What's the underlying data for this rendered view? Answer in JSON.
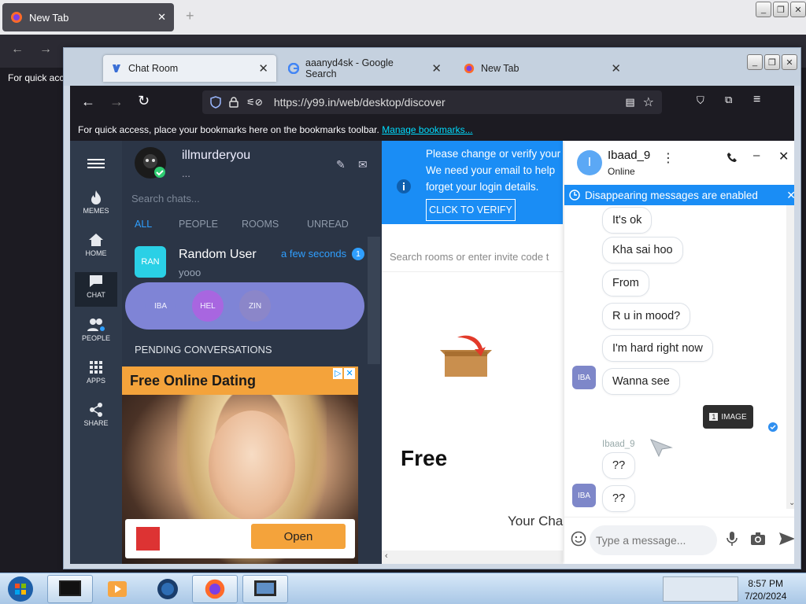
{
  "bg_window": {
    "tab_title": "New Tab",
    "bookmarks_text": "For quick acc"
  },
  "window": {
    "tabs": [
      {
        "label": "Chat Room",
        "active": true
      },
      {
        "label": "aaanyd4sk - Google Search"
      },
      {
        "label": "New Tab"
      }
    ],
    "url": "https://y99.in/web/desktop/discover",
    "bookmarks_bar": {
      "text": "For quick access, place your bookmarks here on the bookmarks toolbar.",
      "link": "Manage bookmarks..."
    }
  },
  "rail": {
    "items": [
      {
        "label": "MEMES",
        "icon": "flame-icon"
      },
      {
        "label": "HOME",
        "icon": "home-icon"
      },
      {
        "label": "CHAT",
        "icon": "chat-icon",
        "active": true
      },
      {
        "label": "PEOPLE",
        "icon": "people-icon"
      },
      {
        "label": "APPS",
        "icon": "apps-grid-icon"
      },
      {
        "label": "SHARE",
        "icon": "share-icon"
      }
    ]
  },
  "sidebar": {
    "username": "illmurderyou",
    "status": "...",
    "search_placeholder": "Search chats...",
    "filters": [
      "ALL",
      "PEOPLE",
      "ROOMS",
      "UNREAD"
    ],
    "active_filter": "ALL",
    "chats": [
      {
        "avatar": "RAN",
        "name": "Random User",
        "message": "yooo",
        "time": "a few seconds",
        "unread": "1"
      }
    ],
    "pill_avatars": [
      {
        "label": "IBA",
        "color": "#7f84d6"
      },
      {
        "label": "HEL",
        "color": "#a866e0"
      },
      {
        "label": "ZIN",
        "color": "#8b86c9"
      }
    ],
    "pending_label": "PENDING CONVERSATIONS"
  },
  "ad": {
    "title": "Free Online Dating",
    "button": "Open"
  },
  "middle": {
    "banner_lines": [
      "Please change or verify your",
      "We need your email to help",
      "forget your login details."
    ],
    "verify_button": "CLICK TO VERIFY",
    "search_placeholder": "Search rooms or enter invite code t",
    "free_text": "Free",
    "your_chat_text": "Your Cha"
  },
  "chat": {
    "avatar_letter": "I",
    "name": "Ibaad_9",
    "status": "Online",
    "disappearing_notice": "Disappearing messages are enabled",
    "messages": [
      {
        "text": "It's ok"
      },
      {
        "text": "Kha sai hoo"
      },
      {
        "text": "From"
      },
      {
        "text": "R u in mood?"
      },
      {
        "text": "I'm hard right now"
      },
      {
        "text": "Wanna see",
        "avatar": "IBA"
      },
      {
        "text": "??"
      },
      {
        "text": "??",
        "avatar": "IBA"
      }
    ],
    "sent_image": {
      "count": "1",
      "label": "IMAGE"
    },
    "sender_label": "Ibaad_9",
    "input_placeholder": "Type a message..."
  },
  "taskbar": {
    "time": "8:57 PM",
    "date": "7/20/2024"
  }
}
